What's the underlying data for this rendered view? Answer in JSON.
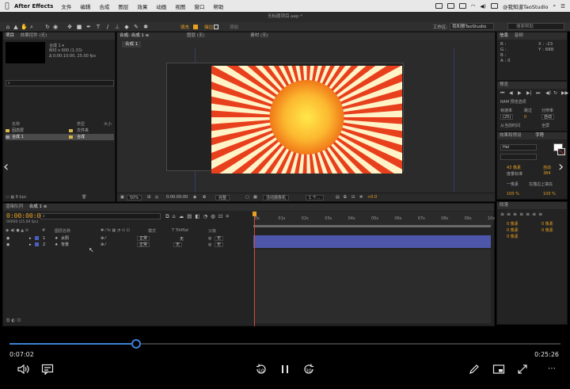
{
  "menubar": {
    "app_name": "After Effects",
    "items": [
      "文件",
      "编辑",
      "合成",
      "图层",
      "效果",
      "动画",
      "视图",
      "窗口",
      "帮助"
    ],
    "user": "@我知道TaoStudio"
  },
  "window": {
    "title": "无标题项目.aep *"
  },
  "toolbar": {
    "fill_label": "填充",
    "stroke_label": "描边",
    "add_label": "添加",
    "none_label": "(无)",
    "workspace_label": "工作区:",
    "workspace_value": "我和颤TaoStudio",
    "search_placeholder": "搜索帮助"
  },
  "project": {
    "tabs": [
      "项目",
      "效果控件 (无)"
    ],
    "comp_name": "合成 1 ▾",
    "comp_size": "800 x 600 (1.33)",
    "comp_duration": "Δ 0:00:10:00, 25.00 fps",
    "columns": {
      "name": "名称",
      "type": "类型",
      "size": "大小"
    },
    "items": [
      {
        "name": "固态层",
        "type": "文件夹",
        "color": "#d6b84a"
      },
      {
        "name": "合成 1",
        "type": "合成",
        "color": "#d6b84a"
      }
    ],
    "footer": "8 bpc"
  },
  "comp_viewer": {
    "tabs": [
      "合成: 合成 1 ≡",
      "图层 (无)",
      "素材 (无)"
    ],
    "sub_tab": "合成 1",
    "zoom": "50%",
    "timecode": "0:00:00:00",
    "resolution": "完整",
    "camera": "活动摄像机",
    "views": "1 个...",
    "exposure": "+0.0"
  },
  "info_panel": {
    "tabs": [
      "信息",
      "音频"
    ],
    "r": "R :",
    "g": "G :",
    "b": "B :",
    "a": "A : 0",
    "x": "X : -23",
    "y": "Y : 688"
  },
  "preview_panel": {
    "title": "预览",
    "ram": "RAM 预览选项",
    "frame_rate_label": "帧速率",
    "skip_label": "跳过",
    "resolution_label": "分辨率",
    "frame_rate": "(25)",
    "skip": "0",
    "resolution": "自动",
    "from_current": "从当前时间",
    "fullscreen": "全屏"
  },
  "character_panel": {
    "tabs": [
      "效果和预设",
      "字符"
    ],
    "font": "Hei",
    "size": "43 像素",
    "leading": "自动",
    "kerning": "度量标准",
    "tracking": "384",
    "stroke": "一像素",
    "stroke_type": "在描边上填充",
    "h_scale": "100 %",
    "v_scale": "100 %"
  },
  "paragraph_panel": {
    "title": "段落",
    "indent_left": "0 像素",
    "indent_right": "0 像素",
    "indent_first": "0 像素",
    "space_before": "0 像素",
    "space_after": "0 像素"
  },
  "timeline": {
    "tabs": [
      "渲染队列",
      "合成 1 ≡"
    ],
    "current_time": "0:00:00:00",
    "fps": "00000 (25.00 fps)",
    "ruler_ticks": [
      "0s",
      "01s",
      "02s",
      "03s",
      "04s",
      "05s",
      "06s",
      "07s",
      "08s",
      "09s",
      "10s"
    ],
    "columns": {
      "num": "#",
      "layer_name": "图层名称",
      "mode": "模式",
      "trkmat": "T TrkMat",
      "parent": "父级"
    },
    "layers": [
      {
        "num": "1",
        "name": "太阳",
        "mode": "正常",
        "trkmat": "无",
        "parent": "无"
      },
      {
        "num": "2",
        "name": "背景",
        "mode": "正常",
        "trkmat": "无",
        "parent": "无"
      }
    ]
  },
  "player": {
    "current_time": "0:07:02",
    "total_time": "0:25:26",
    "progress": 0.2295,
    "skip_back_label": "10",
    "skip_fwd_label": "30"
  },
  "colors": {
    "accent_orange": "#e8a020",
    "progress_blue": "#3d7fd4",
    "layer_bar": "#4d56a8",
    "sun_center": "#ffe84a",
    "sun_edge": "#f07818",
    "ray_red": "#e8401c",
    "ray_cream": "#fff3c8"
  }
}
